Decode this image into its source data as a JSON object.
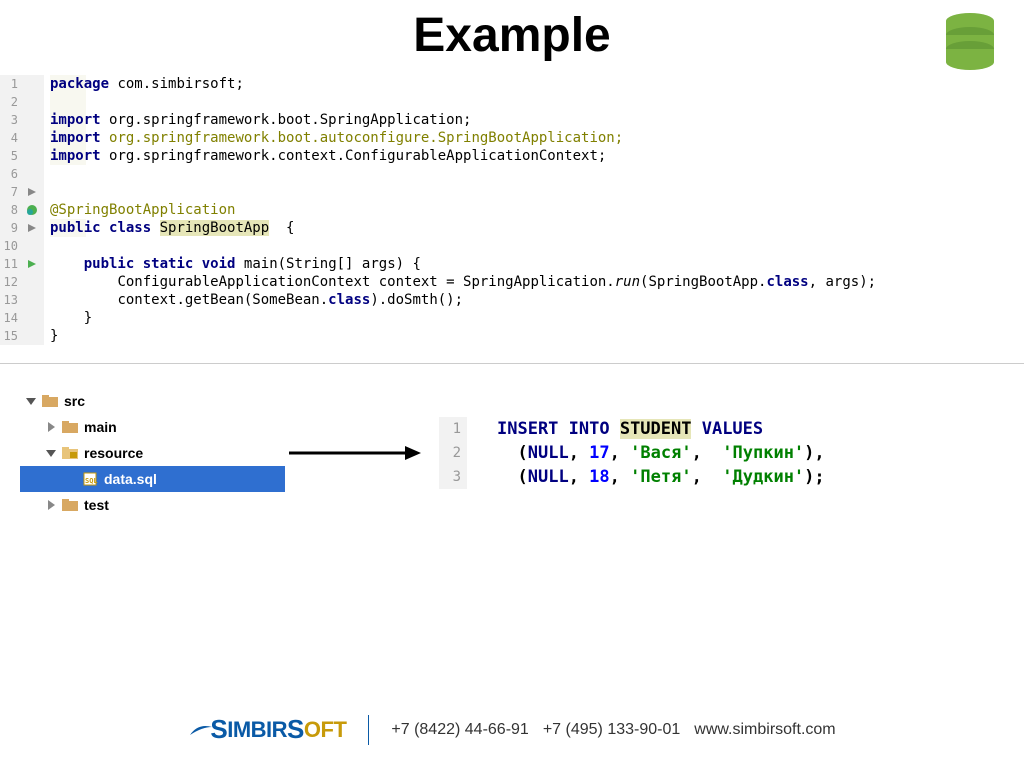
{
  "title": "Example",
  "code": {
    "lines": [
      {
        "n": "1",
        "pkg": "package ",
        "rest": "com.simbirsoft;"
      },
      {
        "n": "2",
        "blank": true
      },
      {
        "n": "3",
        "imp": "import ",
        "rest": "org.springframework.boot.SpringApplication;"
      },
      {
        "n": "4",
        "imp": "import ",
        "rest": "org.springframework.boot.autoconfigure.SpringBootApplication;",
        "olive": true
      },
      {
        "n": "5",
        "imp": "import ",
        "rest": "org.springframework.context.ConfigurableApplicationContext;"
      },
      {
        "n": "6",
        "blank": true
      },
      {
        "n": "7",
        "blank": true,
        "marker": "tri"
      },
      {
        "n": "8",
        "ann": "@SpringBootApplication",
        "marker": "circle"
      },
      {
        "n": "9",
        "cls": true,
        "marker": "tri"
      },
      {
        "n": "10",
        "blank": true
      },
      {
        "n": "11",
        "main": true,
        "marker": "tri"
      },
      {
        "n": "12",
        "ctx": true,
        "indent": true
      },
      {
        "n": "13",
        "bean": true,
        "indent": true
      },
      {
        "n": "14",
        "close1": true
      },
      {
        "n": "15",
        "close2": true
      }
    ],
    "packageKw": "package ",
    "packageName": "com.simbirsoft;",
    "importKw": "import ",
    "import1": "org.springframework.boot.SpringApplication;",
    "import2": "org.springframework.boot.autoconfigure.SpringBootApplication;",
    "import3": "org.springframework.context.ConfigurableApplicationContext;",
    "annotation": "@SpringBootApplication",
    "publicKw": "public ",
    "classKw": "class ",
    "className": "SpringBootApp",
    "openBrace": "  {",
    "staticKw": "static ",
    "voidKw": "void ",
    "mainSig": "main(String[] args) {",
    "ctxLine_a": "ConfigurableApplicationContext context = SpringApplication.",
    "runKw": "run",
    "ctxLine_b": "(SpringBootApp.",
    "classRef": "class",
    "ctxLine_c": ", args);",
    "bean_a": "context.getBean(SomeBean.",
    "bean_b": ").doSmth();",
    "close1": "}",
    "close2": "}"
  },
  "tree": {
    "src": "src",
    "main": "main",
    "resource": "resource",
    "datasql": "data.sql",
    "test": "test"
  },
  "sql": {
    "l1_a": "INSERT INTO ",
    "l1_student": "STUDENT",
    "l1_b": " VALUES",
    "l2_a": "(",
    "null": "NULL",
    "l2_b": ", ",
    "n17": "17",
    "l2_c": ", ",
    "vasya": "'Вася'",
    "l2_d": ",  ",
    "pupkin": "'Пупкин'",
    "l2_e": "),",
    "n18": "18",
    "petya": "'Петя'",
    "dudkin": "'Дудкин'",
    "l3_e": ");"
  },
  "footer": {
    "brand_s": "S",
    "brand_imbir": "IMBIR",
    "brand_s2": "S",
    "brand_oft": "OFT",
    "phone1": "+7 (8422) 44-66-91",
    "phone2": "+7 (495) 133-90-01",
    "url": "www.simbirsoft.com"
  }
}
